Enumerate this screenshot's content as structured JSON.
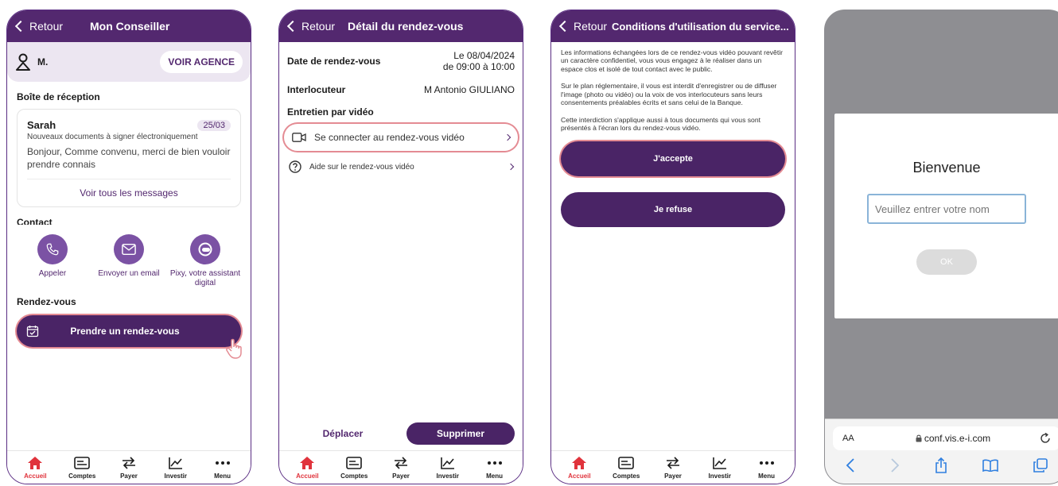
{
  "screen1": {
    "back": "Retour",
    "title": "Mon Conseiller",
    "user_name": "M.",
    "agency_button": "VOIR AGENCE",
    "inbox_title": "Boîte de réception",
    "message": {
      "sender": "Sarah",
      "date": "25/03",
      "subject": "Nouveaux documents à signer électroniquement",
      "preview": "Bonjour, Comme convenu, merci de bien vouloir prendre connais"
    },
    "all_messages": "Voir tous les messages",
    "contact_title": "Contact",
    "contacts": [
      "Appeler",
      "Envoyer un email",
      "Pixy, votre assistant digital"
    ],
    "rdv_title": "Rendez-vous",
    "rdv_button": "Prendre un rendez-vous"
  },
  "screen2": {
    "back": "Retour",
    "title": "Détail du rendez-vous",
    "date_label": "Date de rendez-vous",
    "date_value": "Le 08/04/2024",
    "time_value": "de 09:00 à 10:00",
    "contact_label": "Interlocuteur",
    "contact_value": "M Antonio GIULIANO",
    "video_label": "Entretien par vidéo",
    "connect_label": "Se connecter au rendez-vous vidéo",
    "help_label": "Aide sur le rendez-vous vidéo",
    "move_button": "Déplacer",
    "delete_button": "Supprimer"
  },
  "screen3": {
    "back": "Retour",
    "title": "Conditions d'utilisation du service...",
    "paragraphs": [
      "Les informations échangées lors de ce rendez-vous vidéo pouvant revêtir un caractère confidentiel, vous vous engagez à le réaliser dans un espace clos et isolé de tout contact avec le public.",
      "Sur le plan réglementaire, il vous est interdit d'enregistrer ou de diffuser l'image (photo ou vidéo) ou la voix de vos interlocuteurs sans leurs consentements préalables écrits et sans celui de la Banque.",
      "Cette interdiction s'applique aussi à tous documents qui vous sont présentés à l'écran lors du rendez-vous vidéo."
    ],
    "accept_button": "J'accepte",
    "refuse_button": "Je refuse"
  },
  "screen4": {
    "welcome": "Bienvenue",
    "name_placeholder": "Veuillez entrer votre nom",
    "ok_button": "OK",
    "text_size": "AA",
    "url": "conf.vis.e-i.com"
  },
  "tabs": [
    "Accueil",
    "Comptes",
    "Payer",
    "Investir",
    "Menu"
  ],
  "colors": {
    "brand_purple": "#53286f",
    "button_purple": "#4a2466",
    "highlight_pink": "#e48b93",
    "active_red": "#e0333c"
  }
}
